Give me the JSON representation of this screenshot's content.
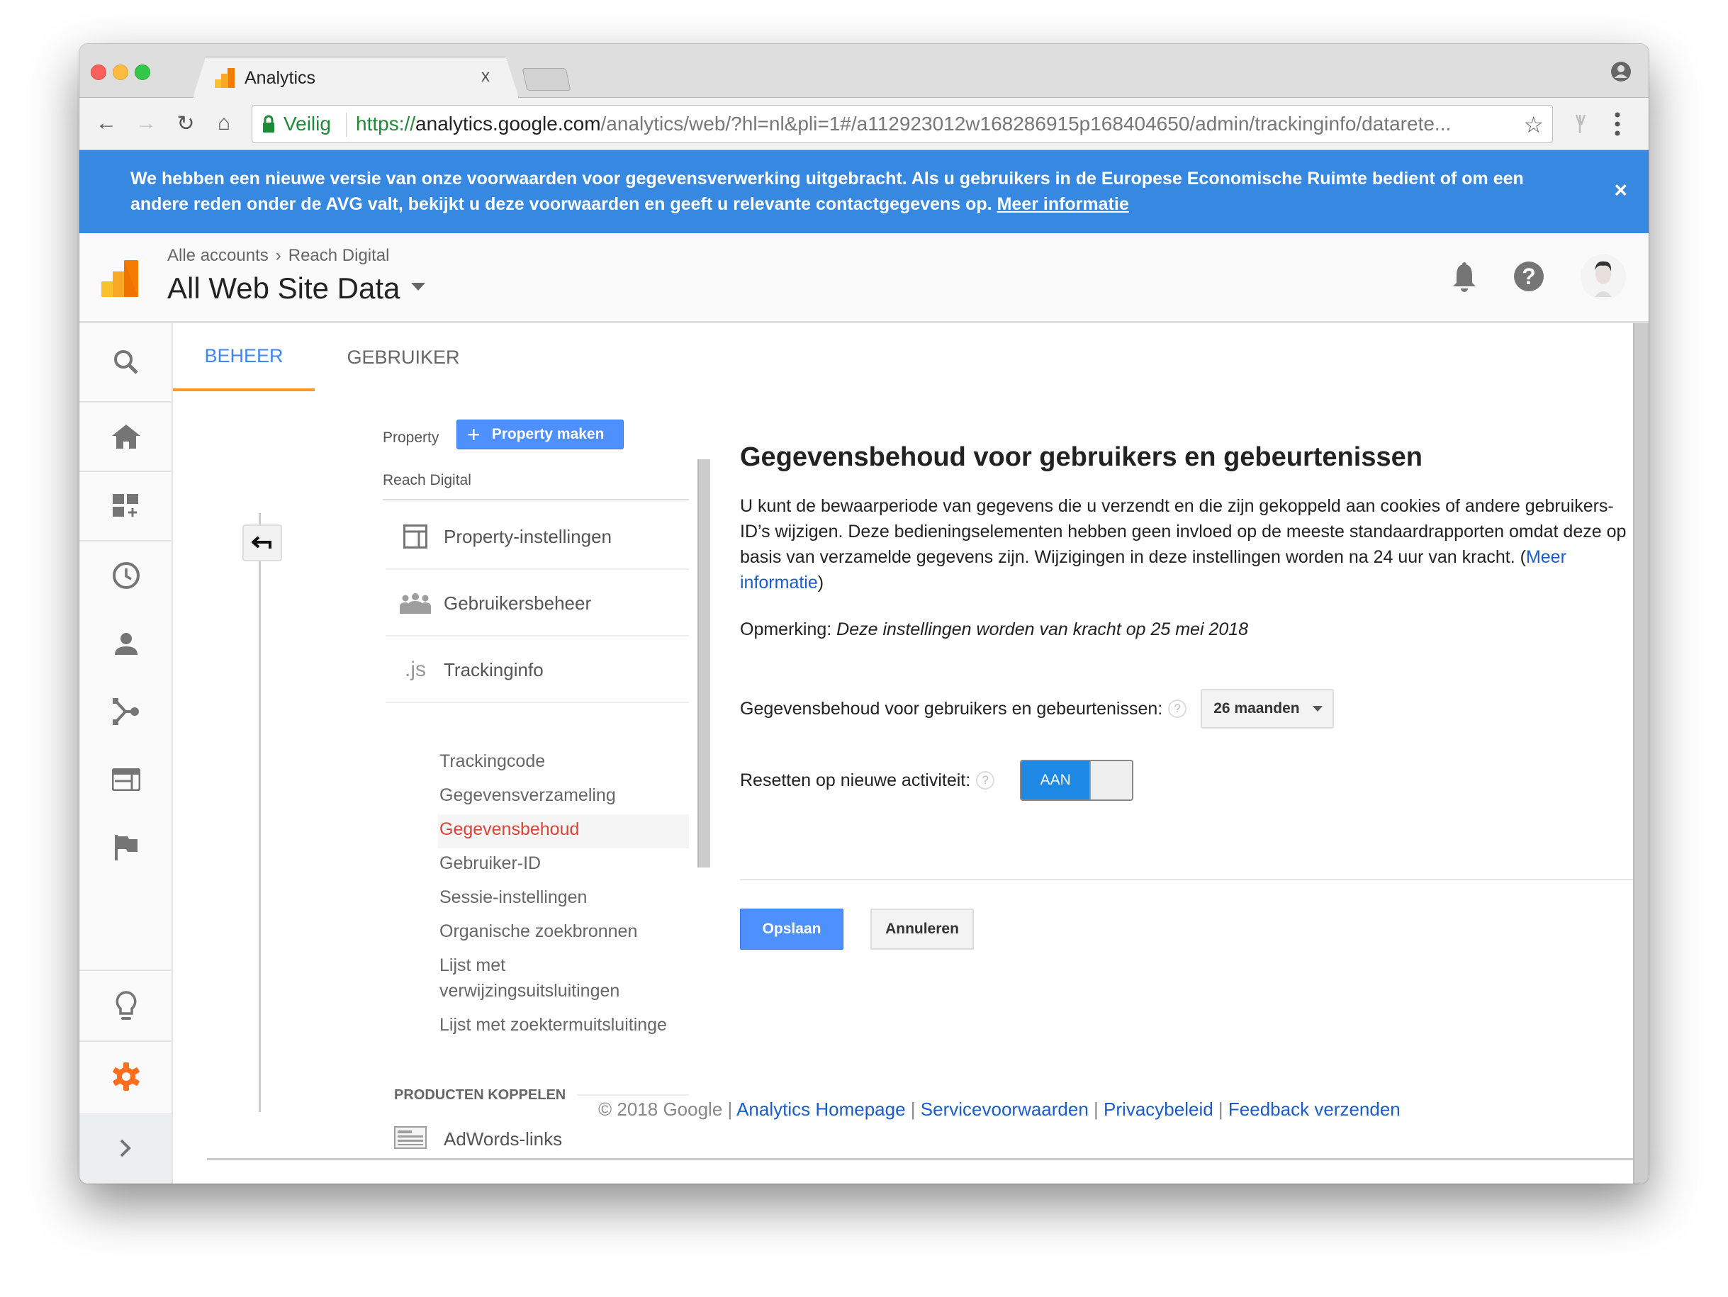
{
  "browser": {
    "tab_title": "Analytics",
    "tab_close": "x",
    "secure_label": "Veilig",
    "url_scheme": "https://",
    "url_host": "analytics.google.com",
    "url_path": "/analytics/web/?hl=nl&pli=1#/a112923012w168286915p168404650/admin/trackinginfo/datarete..."
  },
  "banner": {
    "text": "We hebben een nieuwe versie van onze voorwaarden voor gegevensverwerking uitgebracht. Als u gebruikers in de Europese Economische Ruimte bedient of om een andere reden onder de AVG valt, bekijkt u deze voorwaarden en geeft u relevante contactgegevens op.",
    "link": "Meer informatie",
    "close": "×",
    "color": "#3688e0"
  },
  "header": {
    "breadcrumb": [
      "Alle accounts",
      "Reach Digital"
    ],
    "breadcrumb_sep": "›",
    "view_title": "All Web Site Data"
  },
  "tabs": {
    "beheer": "BEHEER",
    "gebruiker": "GEBRUIKER",
    "active_color": "#4285f4",
    "underline_color": "#f7982a"
  },
  "admin": {
    "property_label": "Property",
    "create_property": "Property maken",
    "property_name": "Reach Digital",
    "sections": [
      {
        "label": "Property-instellingen",
        "icon": "property-settings-icon"
      },
      {
        "label": "Gebruikersbeheer",
        "icon": "user-management-icon"
      },
      {
        "label": "Trackinginfo",
        "icon": "js-icon",
        "icon_text": ".js"
      }
    ],
    "subitems": [
      "Trackingcode",
      "Gegevensverzameling",
      "Gegevensbehoud",
      "Gebruiker-ID",
      "Sessie-instellingen",
      "Organische zoekbronnen",
      "Lijst met verwijzingsuitsluitingen",
      "Lijst met zoektermuitsluitinge"
    ],
    "active_subitem": "Gegevensbehoud",
    "active_color": "#db4437",
    "products_heading": "PRODUCTEN KOPPELEN",
    "adwords_label": "AdWords-links"
  },
  "content": {
    "title": "Gegevensbehoud voor gebruikers en gebeurtenissen",
    "description": "U kunt de bewaarperiode van gegevens die u verzendt en die zijn gekoppeld aan cookies of andere gebruikers-ID’s wijzigen. Deze bedieningselementen hebben geen invloed op de meeste standaardrapporten omdat deze op basis van verzamelde gegevens zijn. Wijzigingen in deze instellingen worden na 24 uur van kracht. (",
    "description_link": "Meer informatie",
    "description_end": ")",
    "note_label": "Opmerking:",
    "note_text": "Deze instellingen worden van kracht op 25 mei 2018",
    "retention_label": "Gegevensbehoud voor gebruikers en gebeurtenissen:",
    "retention_value": "26 maanden",
    "reset_label": "Resetten op nieuwe activiteit:",
    "reset_toggle": "AAN",
    "reset_on": true,
    "help": "?",
    "save": "Opslaan",
    "cancel": "Annuleren"
  },
  "footer": {
    "copyright": "© 2018 Google",
    "sep": "|",
    "links": [
      "Analytics Homepage",
      "Servicevoorwaarden",
      "Privacybeleid",
      "Feedback verzenden"
    ]
  }
}
